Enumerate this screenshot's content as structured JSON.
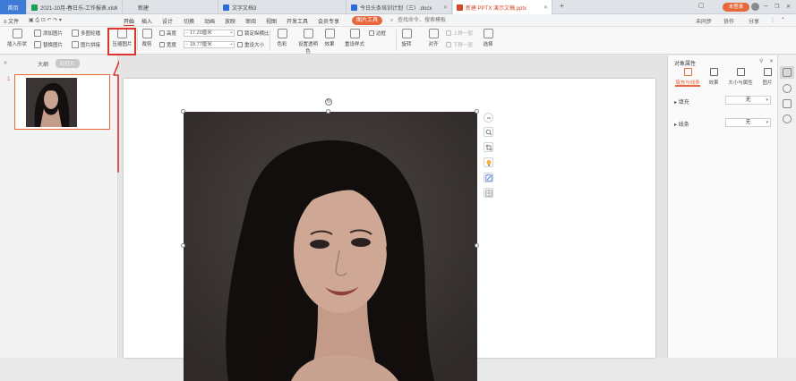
{
  "tabs": [
    {
      "label": "首页",
      "kind": "home"
    },
    {
      "label": "2021-10月-春日乐-工作报表.xlsx",
      "color": "#1e9e55"
    },
    {
      "label": "新建",
      "color": ""
    },
    {
      "label": "文字文档3",
      "color": "#2b6cd9"
    },
    {
      "label": "今日头条培训计划（三）.docx",
      "color": "#2b6cd9"
    },
    {
      "label": "新建 PPTX 演示文稿.pptx",
      "color": "#d24726"
    }
  ],
  "menu": {
    "file": "≡ 文件",
    "items": [
      "开始",
      "插入",
      "设计",
      "切换",
      "动画",
      "放映",
      "审阅",
      "视图",
      "开发工具",
      "会员专享"
    ],
    "picture_tools": "图片工具",
    "search": "查找命令、搜索模板",
    "unsynced": "未同步",
    "collab": "协作",
    "share": "分享",
    "login": "未登录"
  },
  "ribbon": {
    "insert_shape": "插入形状",
    "add_picture": "添加图片",
    "replace_picture": "替换图片",
    "multi_picture": "多图轮播",
    "picture_stitch": "图片拼接",
    "compress": "压缩图片",
    "height_label": "高度",
    "height_value": "17.20厘米",
    "width_label": "宽度",
    "width_value": "18.77厘米",
    "lock_ratio": "锁定纵横比",
    "reset_size": "重设大小",
    "crop": "裁剪",
    "color": "色彩",
    "transparent": "设置透明色",
    "effects": "效果",
    "reset_style": "重设样式",
    "border": "边框",
    "rotate": "旋转",
    "align": "对齐",
    "move_up": "上移一层",
    "move_down": "下移一层",
    "select": "选择"
  },
  "left_panel": {
    "outline": "大纲",
    "slides": "幻灯片",
    "slide_number": "1"
  },
  "right_panel": {
    "title": "对象属性",
    "tabs": [
      "填充与线条",
      "效果",
      "大小与属性",
      "图片"
    ],
    "fill_label": "填充",
    "fill_value": "无",
    "line_label": "线条",
    "line_value": "无"
  },
  "colors": {
    "accent": "#e9683b",
    "highlight": "#e0322f",
    "home_tab": "#3d7bd6"
  }
}
